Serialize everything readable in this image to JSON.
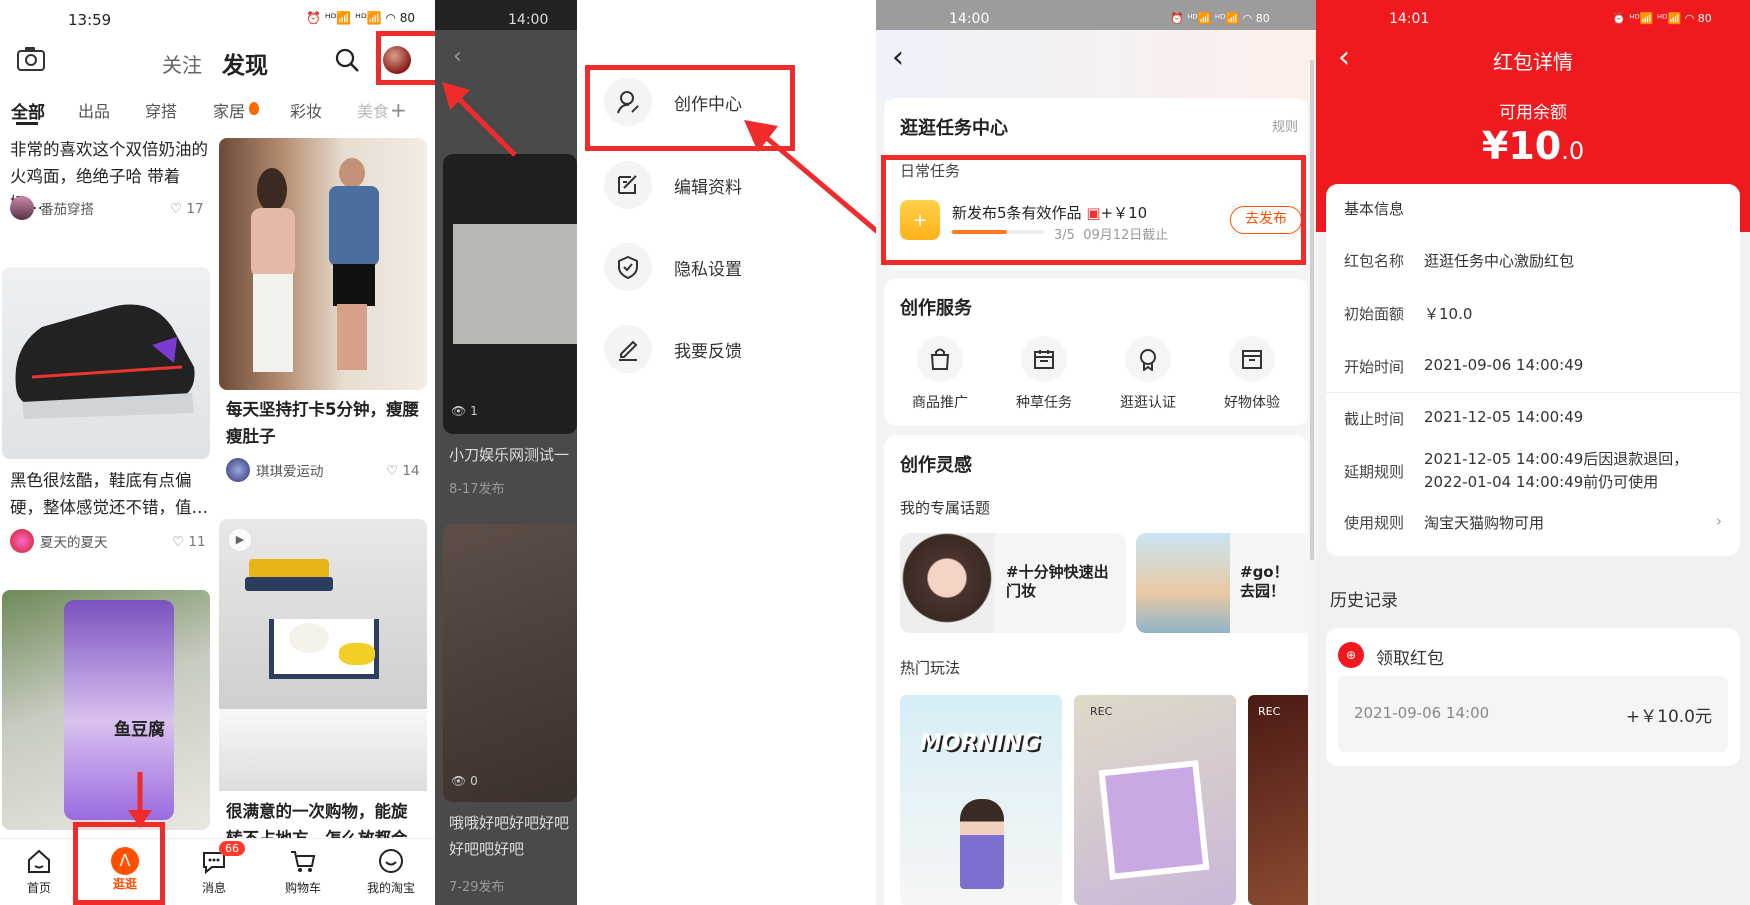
{
  "p1": {
    "time": "13:59",
    "status_right": "⏰ ᴴᴰ📶 ᴴᴰ📶 ◠ 80",
    "nav": {
      "follow": "关注",
      "discover": "发现"
    },
    "tabs": [
      "全部",
      "出品",
      "穿搭",
      "家居",
      "彩妆",
      "美食"
    ],
    "cards": [
      {
        "caption": "非常的喜欢这个双倍奶油的火鸡面，绝绝子哈 带着奶…",
        "author": "番茄穿搭",
        "likes": "17"
      },
      {
        "caption": "每天坚持打卡5分钟，瘦腰瘦肚子",
        "author": "琪琪爱运动",
        "likes": "14"
      },
      {
        "caption": "黑色很炫酷，鞋底有点偏硬，整体感觉还不错，值…",
        "author": "夏天的夏天",
        "likes": "11"
      },
      {
        "caption": "很满意的一次购物，能旋转不占地方，怎么放都合适…",
        "author": "",
        "likes": ""
      }
    ],
    "snack_label": "鱼豆腐",
    "tabbar": [
      {
        "label": "首页"
      },
      {
        "label": "逛逛"
      },
      {
        "label": "消息",
        "badge": "66"
      },
      {
        "label": "购物车"
      },
      {
        "label": "我的淘宝"
      }
    ]
  },
  "p2": {
    "time": "14:00",
    "items": [
      {
        "title": "小刀娱乐网测试一",
        "date": "8-17发布",
        "views": "1"
      },
      {
        "title": "哦哦好吧好吧好吧好吧吧好吧",
        "date": "7-29发布",
        "views": "0"
      }
    ]
  },
  "p3": {
    "menu": [
      {
        "label": "创作中心",
        "icon": "creator-icon"
      },
      {
        "label": "编辑资料",
        "icon": "edit-icon"
      },
      {
        "label": "隐私设置",
        "icon": "shield-icon"
      },
      {
        "label": "我要反馈",
        "icon": "feedback-icon"
      }
    ]
  },
  "p4": {
    "time": "14:00",
    "status_right": "⏰ ᴴᴰ📶 ᴴᴰ📶 ◠ 80",
    "title": "逛逛任务中心",
    "rules": "规则",
    "daily": "日常任务",
    "task": {
      "name": "新发布5条有效作品",
      "reward": "+￥10",
      "progress_text": "3/5",
      "progress": 0.6,
      "deadline": "09月12日截止",
      "button": "去发布"
    },
    "service_title": "创作服务",
    "services": [
      "商品推广",
      "种草任务",
      "逛逛认证",
      "好物体验"
    ],
    "insp_title": "创作灵感",
    "topics_title": "我的专属话题",
    "topics": [
      "#十分钟快速出门妆",
      "#go！去园！"
    ],
    "hot_title": "热门玩法",
    "hot": [
      "MORNING",
      "REC",
      "REC"
    ]
  },
  "p5": {
    "time": "14:01",
    "status_right": "⏰ ᴴᴰ📶 ᴴᴰ📶 ◠ 80",
    "title": "红包详情",
    "avail_label": "可用余额",
    "amount_int": "¥10",
    "amount_dec": ".0",
    "info_title": "基本信息",
    "rows": [
      {
        "k": "红包名称",
        "v": "逛逛任务中心激励红包"
      },
      {
        "k": "初始面额",
        "v": "￥10.0"
      },
      {
        "k": "开始时间",
        "v": "2021-09-06 14:00:49"
      },
      {
        "k": "截止时间",
        "v": "2021-12-05 14:00:49"
      },
      {
        "k": "延期规则",
        "v": "2021-12-05 14:00:49后因退款退回，\n2022-01-04 14:00:49前仍可使用"
      },
      {
        "k": "使用规则",
        "v": "淘宝天猫购物可用"
      }
    ],
    "history_title": "历史记录",
    "history_item": "领取红包",
    "history_time": "2021-09-06 14:00",
    "history_amount": "+￥10.0元"
  },
  "colors": {
    "accent": "#ff5000",
    "highlight": "#ef2b2b",
    "red": "#f0191e"
  }
}
